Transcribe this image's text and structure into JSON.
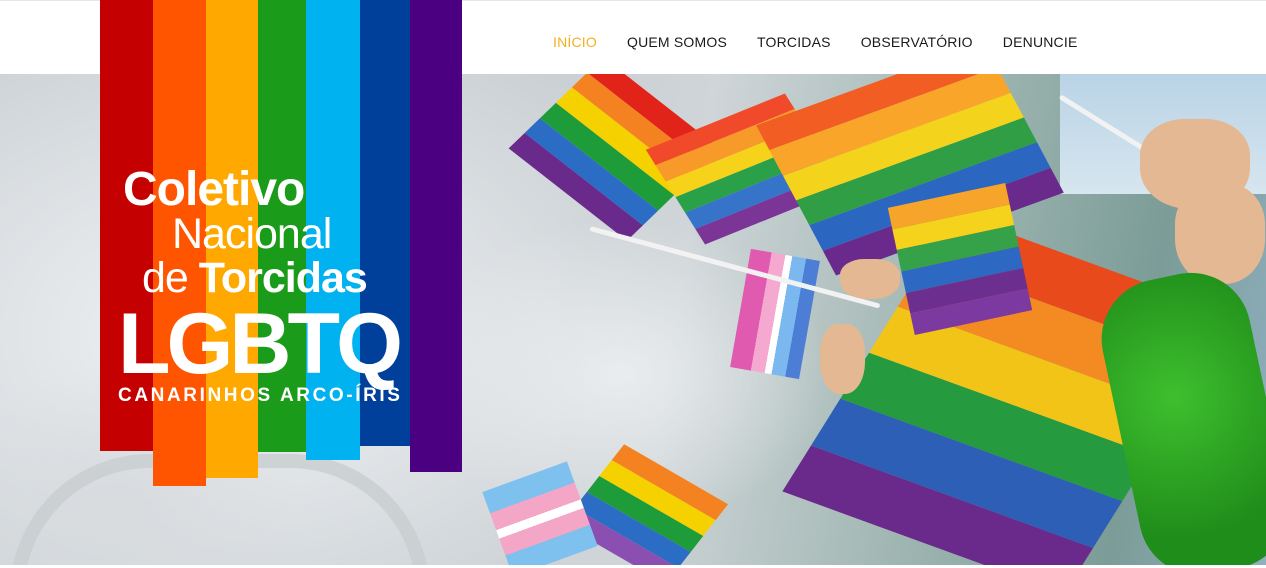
{
  "nav": {
    "items": [
      {
        "label": "INÍCIO",
        "active": true
      },
      {
        "label": "QUEM SOMOS",
        "active": false
      },
      {
        "label": "TORCIDAS",
        "active": false
      },
      {
        "label": "OBSERVATÓRIO",
        "active": false
      },
      {
        "label": "DENUNCIE",
        "active": false
      }
    ]
  },
  "logo": {
    "line1": "Coletivo",
    "line2": "Nacional",
    "line3_prefix": "de ",
    "line3_bold": "Torcidas",
    "line4": "LGBTQ",
    "line5": "CANARINHOS ARCO-ÍRIS",
    "stripe_colors": [
      "#c40000",
      "#ff5500",
      "#ffa800",
      "#1a9b1a",
      "#00b2ef",
      "#003f9a",
      "#4b0082"
    ]
  },
  "colors": {
    "nav_active": "#f2b01e",
    "nav_text": "#1a1a1a",
    "rainbow": [
      "#e2231a",
      "#f58220",
      "#f5d100",
      "#1f9c3a",
      "#2b6cc4",
      "#6a2a8c"
    ]
  },
  "hero": {
    "image": "pride-flags-crowd-photo"
  }
}
